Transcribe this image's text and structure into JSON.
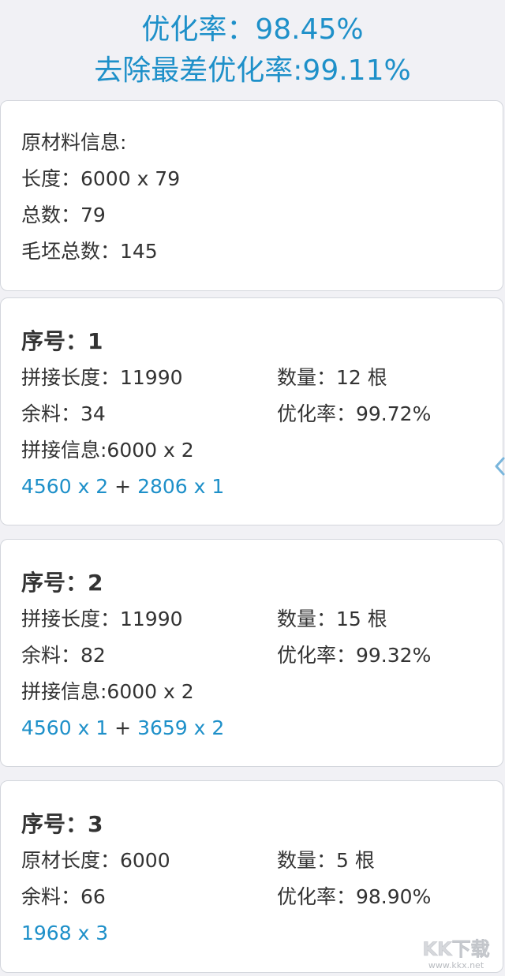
{
  "header": {
    "rate_line": "优化率：98.45%",
    "rate_excl_worst_line": "去除最差优化率:99.11%"
  },
  "raw_info": {
    "title": "原材料信息:",
    "length": "长度：6000 x 79",
    "total": "总数：79",
    "blank_total": "毛坯总数：145"
  },
  "items": [
    {
      "title": "序号：1",
      "row1_left": "拼接长度：11990",
      "row1_right": "数量：12 根",
      "row2_left": "余料：34",
      "row2_right": "优化率：99.72%",
      "splice": "拼接信息:6000 x 2",
      "parts": [
        "4560 x 2",
        "2806 x 1"
      ]
    },
    {
      "title": "序号：2",
      "row1_left": "拼接长度：11990",
      "row1_right": "数量：15 根",
      "row2_left": "余料：82",
      "row2_right": "优化率：99.32%",
      "splice": "拼接信息:6000 x 2",
      "parts": [
        "4560 x 1",
        "3659 x 2"
      ]
    },
    {
      "title": "序号：3",
      "row1_left": "原材长度：6000",
      "row1_right": "数量：5 根",
      "row2_left": "余料：66",
      "row2_right": "优化率：98.90%",
      "parts": [
        "1968 x 3"
      ]
    }
  ],
  "separator": "+",
  "watermark": {
    "brand": "KK下载",
    "url": "www.kkx.net"
  },
  "colors": {
    "accent": "#1e90c9",
    "background": "#f1f1f5",
    "card": "#ffffff",
    "text": "#333333"
  },
  "icons": {
    "side_handle": "chevron-left-icon"
  }
}
